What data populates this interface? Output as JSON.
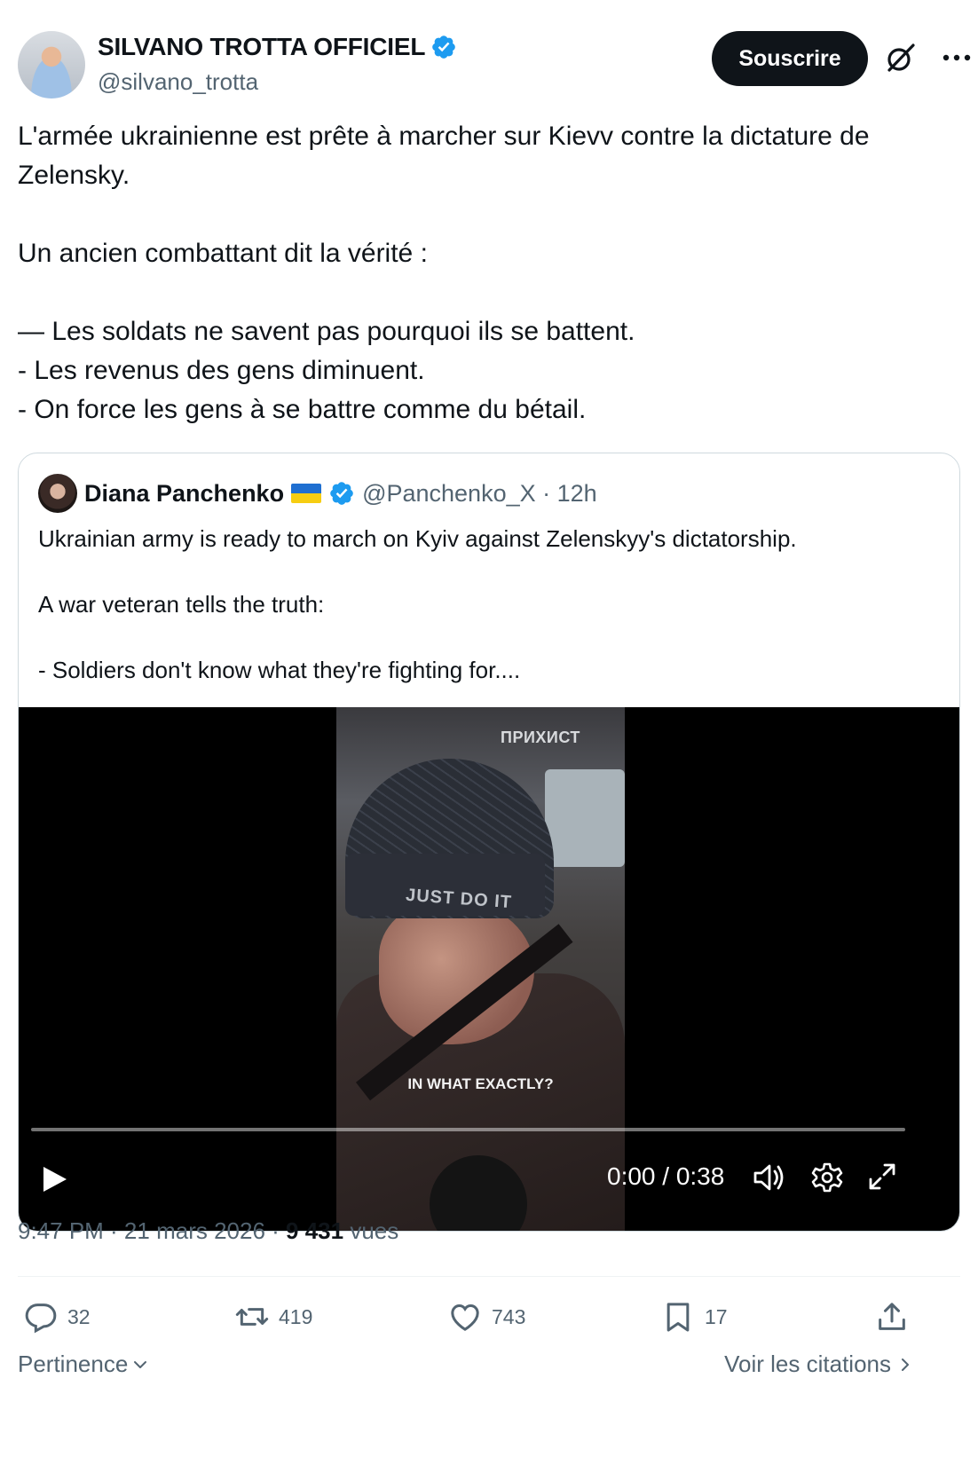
{
  "author": {
    "name": "SILVANO TROTTA OFFICIEL",
    "handle": "@silvano_trotta"
  },
  "header": {
    "subscribe_label": "Souscrire"
  },
  "tweet": {
    "text": "L'armée ukrainienne est prête à marcher sur Kievv contre la dictature de Zelensky.\n\nUn ancien combattant dit la vérité :\n\n— Les soldats ne savent pas pourquoi ils se battent.\n- Les revenus des gens diminuent.\n- On force les gens à se battre comme du bétail."
  },
  "quote": {
    "name": "Diana Panchenko",
    "handle_time": "@Panchenko_X · 12h",
    "text": "Ukrainian army is ready to march on Kyiv against Zelenskyy's dictatorship.\n\nA war veteran tells the truth:\n\n- Soldiers don't know what they're fighting for....",
    "video": {
      "watermark": "ПРИХИСТ",
      "hat_text": "JUST DO IT",
      "subtitle": "IN WHAT EXACTLY?",
      "time": "0:00 / 0:38",
      "progress": 0
    }
  },
  "meta": {
    "time_date": "9:47 PM · 21 mars 2026 · ",
    "views_count": "9 431",
    "views_label": " vues"
  },
  "actions": {
    "replies": "32",
    "reposts": "419",
    "likes": "743",
    "bookmarks": "17"
  },
  "footer": {
    "sort_label": "Pertinence",
    "quotes_link": "Voir les citations"
  },
  "colors": {
    "accent": "#1d9bf0",
    "text": "#0f1419",
    "muted": "#536471",
    "border": "#cfd9de"
  }
}
